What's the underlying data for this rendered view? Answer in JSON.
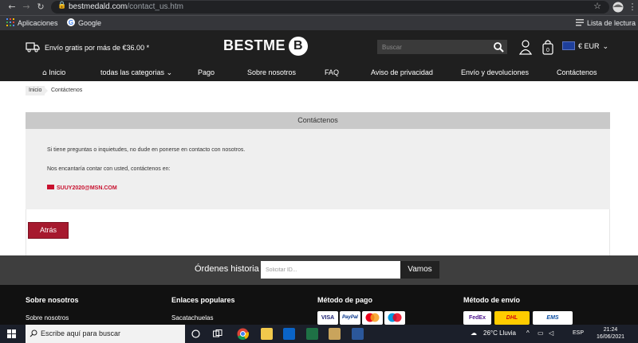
{
  "browser": {
    "url_host": "bestmedald.com",
    "url_path": "/contact_us.htm",
    "bookmarks": [
      {
        "label": "Aplicaciones"
      },
      {
        "label": "Google"
      }
    ],
    "reading_list": "Lista de lectura"
  },
  "header": {
    "shipping_text": "Envío gratis por más de €36.00 *",
    "logo_text": "BESTME",
    "logo_letter": "B",
    "search_placeholder": "Buscar",
    "cart_count": "0",
    "currency": "€ EUR",
    "nav": [
      {
        "label": "Inicio",
        "icon": "home-icon"
      },
      {
        "label": "todas las categorias",
        "icon": "chevron-down-icon"
      },
      {
        "label": "Pago"
      },
      {
        "label": "Sobre nosotros"
      },
      {
        "label": "FAQ"
      },
      {
        "label": "Aviso de privacidad"
      },
      {
        "label": "Envío y devoluciones"
      },
      {
        "label": "Contáctenos"
      }
    ]
  },
  "breadcrumb": {
    "home": "Inicio",
    "current": "Contáctenos"
  },
  "contact": {
    "title": "Contáctenos",
    "line1": "Si tiene preguntas o inquietudes, no dude en ponerse en contacto con nosotros.",
    "line2": "Nos encantaría contar con usted, contáctenos en:",
    "email": "SUUY2020@MSN.COM",
    "back_label": "Atrás"
  },
  "orders": {
    "label": "Órdenes historia",
    "placeholder": "Solicitar ID...",
    "button": "Vamos"
  },
  "footer": {
    "columns": [
      {
        "heading": "Sobre nosotros",
        "item": "Sobre nosotros"
      },
      {
        "heading": "Enlaces populares",
        "item": "Sacatachuelas"
      },
      {
        "heading": "Método de pago"
      },
      {
        "heading": "Método de envío"
      }
    ],
    "payments": [
      "VISA",
      "PayPal",
      "mastercard",
      "maestro"
    ],
    "shipping": [
      "FedEx",
      "DHL",
      "EMS"
    ]
  },
  "taskbar": {
    "search_text": "Escribe aquí para buscar",
    "weather": "26°C  Lluvia",
    "lang": "ESP",
    "time": "21:24",
    "date": "16/06/2021"
  },
  "colors": {
    "header_bg": "#1f1f1f",
    "accent_red": "#a6192e",
    "email_red": "#c8102e"
  }
}
